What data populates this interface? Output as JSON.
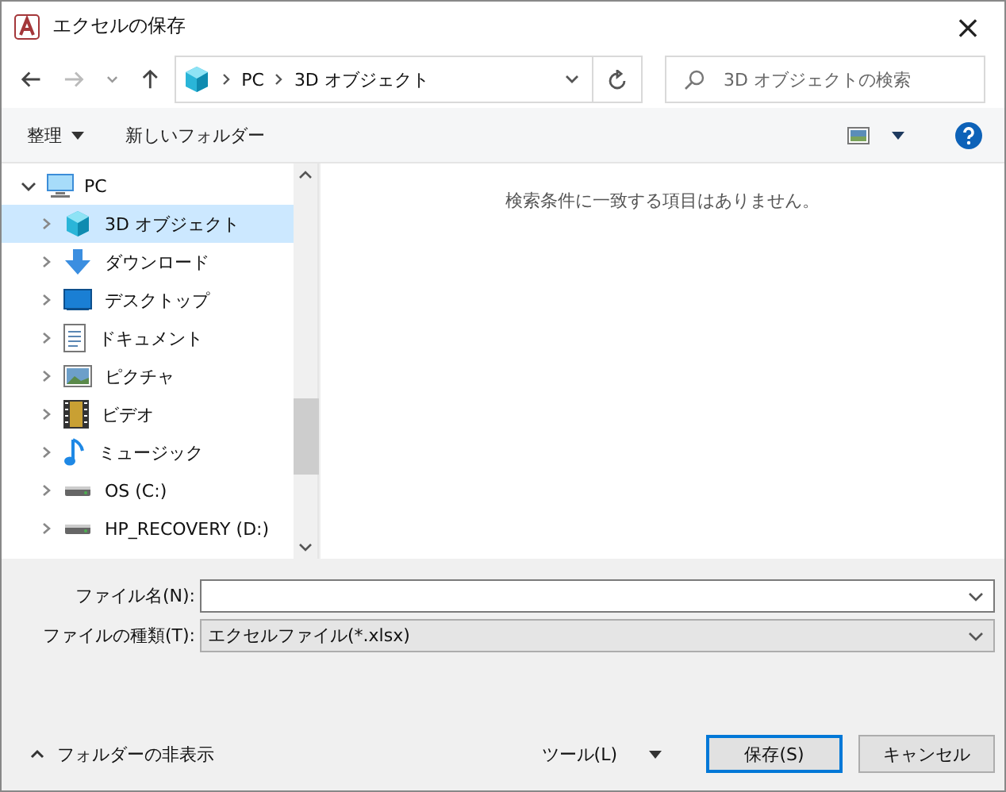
{
  "window": {
    "title": "エクセルの保存",
    "close": "×"
  },
  "nav": {
    "breadcrumb": [
      "PC",
      "3D オブジェクト"
    ],
    "search": {
      "placeholder": "3D オブジェクトの検索"
    }
  },
  "toolbar": {
    "organize": "整理",
    "new_folder": "新しいフォルダー"
  },
  "tree": [
    {
      "label": "PC",
      "kind": "pc",
      "expanded": true,
      "selected": false,
      "children": [
        {
          "label": "3D オブジェクト",
          "kind": "cube",
          "selected": true
        },
        {
          "label": "ダウンロード",
          "kind": "download",
          "selected": false
        },
        {
          "label": "デスクトップ",
          "kind": "desktop",
          "selected": false
        },
        {
          "label": "ドキュメント",
          "kind": "document",
          "selected": false
        },
        {
          "label": "ピクチャ",
          "kind": "picture",
          "selected": false
        },
        {
          "label": "ビデオ",
          "kind": "video",
          "selected": false
        },
        {
          "label": "ミュージック",
          "kind": "music",
          "selected": false
        },
        {
          "label": "OS (C:)",
          "kind": "drive",
          "selected": false
        },
        {
          "label": "HP_RECOVERY (D:)",
          "kind": "drive",
          "selected": false
        }
      ]
    }
  ],
  "content": {
    "empty_message": "検索条件に一致する項目はありません。"
  },
  "form": {
    "file_name": {
      "label": "ファイル名(N):"
    },
    "file_type": {
      "label": "ファイルの種類(T):",
      "value": "エクセルファイル(*.xlsx)"
    }
  },
  "footer": {
    "hide_folders": "フォルダーの非表示",
    "tools": "ツール(L)",
    "save": "保存(S)",
    "cancel": "キャンセル"
  }
}
